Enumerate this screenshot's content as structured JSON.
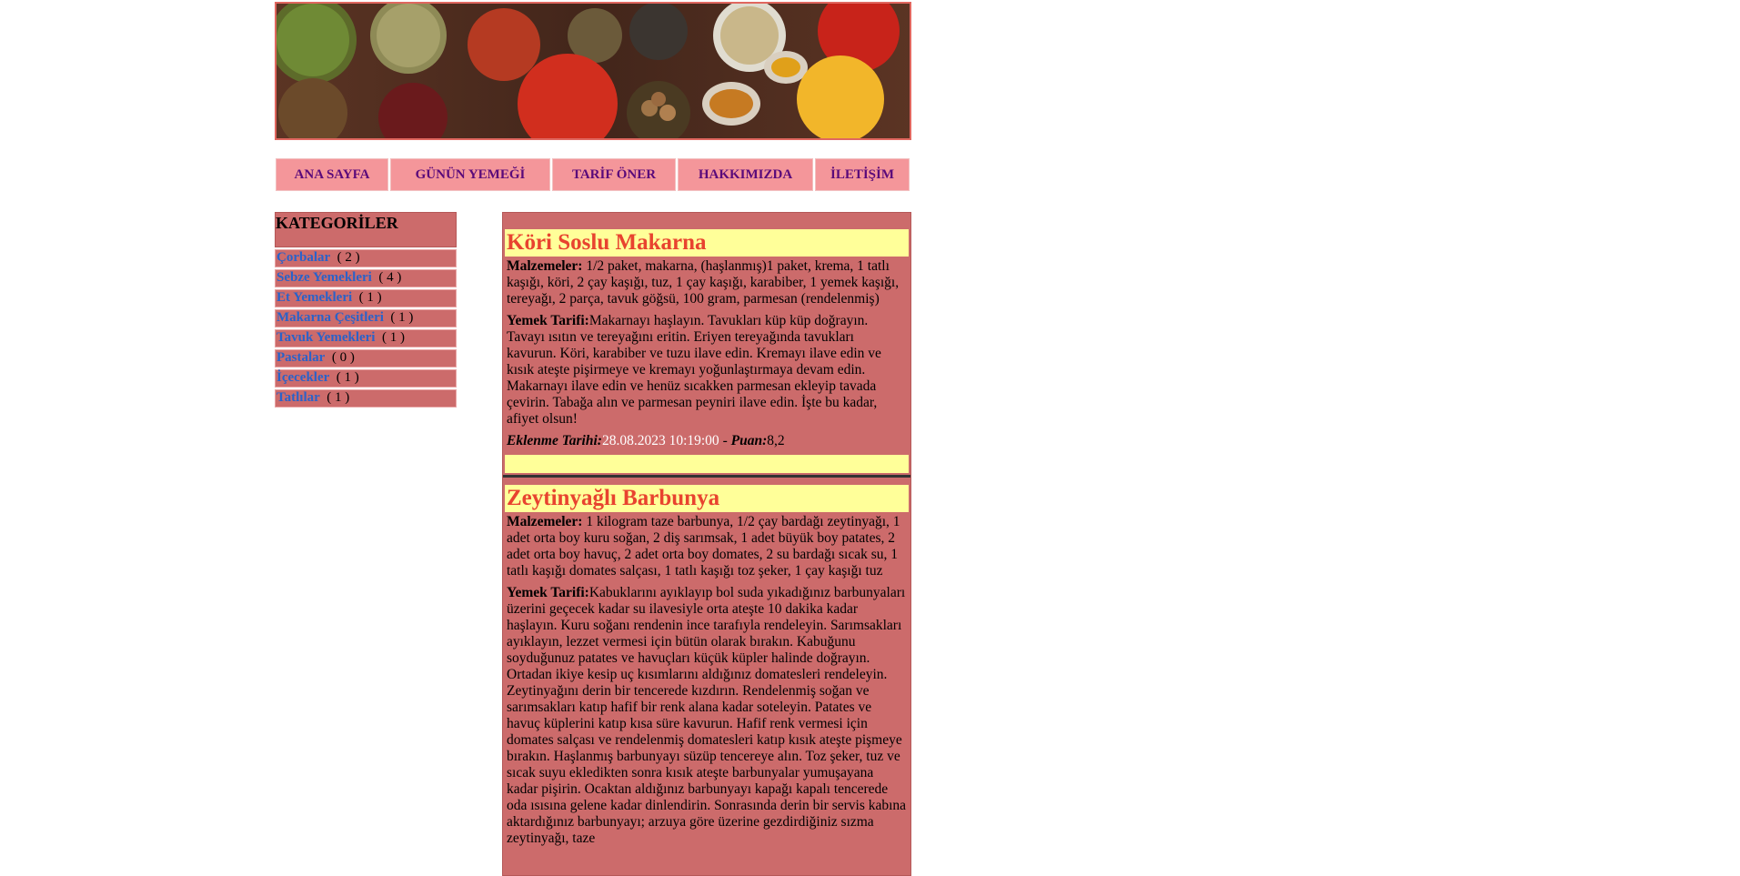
{
  "nav": [
    "ANA SAYFA",
    "GÜNÜN YEMEĞİ",
    "TARİF ÖNER",
    "HAKKIMIZDA",
    "İLETİŞİM"
  ],
  "categories": {
    "title": "KATEGORİLER",
    "items": [
      {
        "name": "Çorbalar",
        "count": "( 2 )"
      },
      {
        "name": "Sebze Yemekleri",
        "count": "( 4 )"
      },
      {
        "name": "Et Yemekleri",
        "count": "( 1 )"
      },
      {
        "name": "Makarna Çeşitleri",
        "count": "( 1 )"
      },
      {
        "name": "Tavuk Yemekleri",
        "count": "( 1 )"
      },
      {
        "name": "Pastalar",
        "count": "( 0 )"
      },
      {
        "name": "İçecekler",
        "count": "( 1 )"
      },
      {
        "name": "Tatlılar",
        "count": "( 1 )"
      }
    ]
  },
  "recipes": [
    {
      "title": "Köri Soslu Makarna",
      "ingredients_label": "Malzemeler:",
      "ingredients": " 1/2 paket, makarna, (haşlanmış)1 paket, krema, 1 tatlı kaşığı, köri, 2 çay kaşığı, tuz, 1 çay kaşığı, karabiber, 1 yemek kaşığı, tereyağı, 2 parça, tavuk göğsü, 100 gram, parmesan (rendelenmiş)",
      "recipe_label": "Yemek Tarifi:",
      "recipe": "Makarnayı haşlayın. Tavukları küp küp doğrayın. Tavayı ısıtın ve tereyağını eritin. Eriyen tereyağında tavukları kavurun. Köri, karabiber ve tuzu ilave edin. Kremayı ilave edin ve kısık ateşte pişirmeye ve kremayı yoğunlaştırmaya devam edin. Makarnayı ilave edin ve henüz sıcakken parmesan ekleyip tavada çevirin. Tabağa alın ve parmesan peyniri ilave edin. İşte bu kadar, afiyet olsun!",
      "date_label": "Eklenme Tarihi:",
      "date": "28.08.2023 10:19:00",
      "sep": " - ",
      "score_label": "Puan:",
      "score": "8,2"
    },
    {
      "title": "Zeytinyağlı Barbunya",
      "ingredients_label": "Malzemeler:",
      "ingredients": " 1 kilogram taze barbunya, 1/2 çay bardağı zeytinyağı, 1 adet orta boy kuru soğan, 2 diş sarımsak, 1 adet büyük boy patates, 2 adet orta boy havuç, 2 adet orta boy domates, 2 su bardağı sıcak su, 1 tatlı kaşığı domates salçası, 1 tatlı kaşığı toz şeker, 1 çay kaşığı tuz",
      "recipe_label": "Yemek Tarifi:",
      "recipe": "Kabuklarını ayıklayıp bol suda yıkadığınız barbunyaları üzerini geçecek kadar su ilavesiyle orta ateşte 10 dakika kadar haşlayın. Kuru soğanı rendenin ince tarafıyla rendeleyin. Sarımsakları ayıklayın, lezzet vermesi için bütün olarak bırakın. Kabuğunu soyduğunuz patates ve havuçları küçük küpler halinde doğrayın. Ortadan ikiye kesip uç kısımlarını aldığınız domatesleri rendeleyin. Zeytinyağını derin bir tencerede kızdırın. Rendelenmiş soğan ve sarımsakları katıp hafif bir renk alana kadar soteleyin. Patates ve havuç küplerini katıp kısa süre kavurun. Hafif renk vermesi için domates salçası ve rendelenmiş domatesleri katıp kısık ateşte pişmeye bırakın. Haşlanmış barbunyayı süzüp tencereye alın. Toz şeker, tuz ve sıcak suyu ekledikten sonra kısık ateşte barbunyalar yumuşayana kadar pişirin. Ocaktan aldığınız barbunyayı kapağı kapalı tencerede oda ısısına gelene kadar dinlendirin. Sonrasında derin bir servis kabına aktardığınız barbunyayı; arzuya göre üzerine gezdirdiğiniz sızma zeytinyağı, taze"
    }
  ],
  "colors": {
    "accent": "#cc6b6b",
    "nav_bg": "#f4969a",
    "title_bg": "#ffff99",
    "title_text": "#e8432f",
    "link": "#2a62c9"
  }
}
